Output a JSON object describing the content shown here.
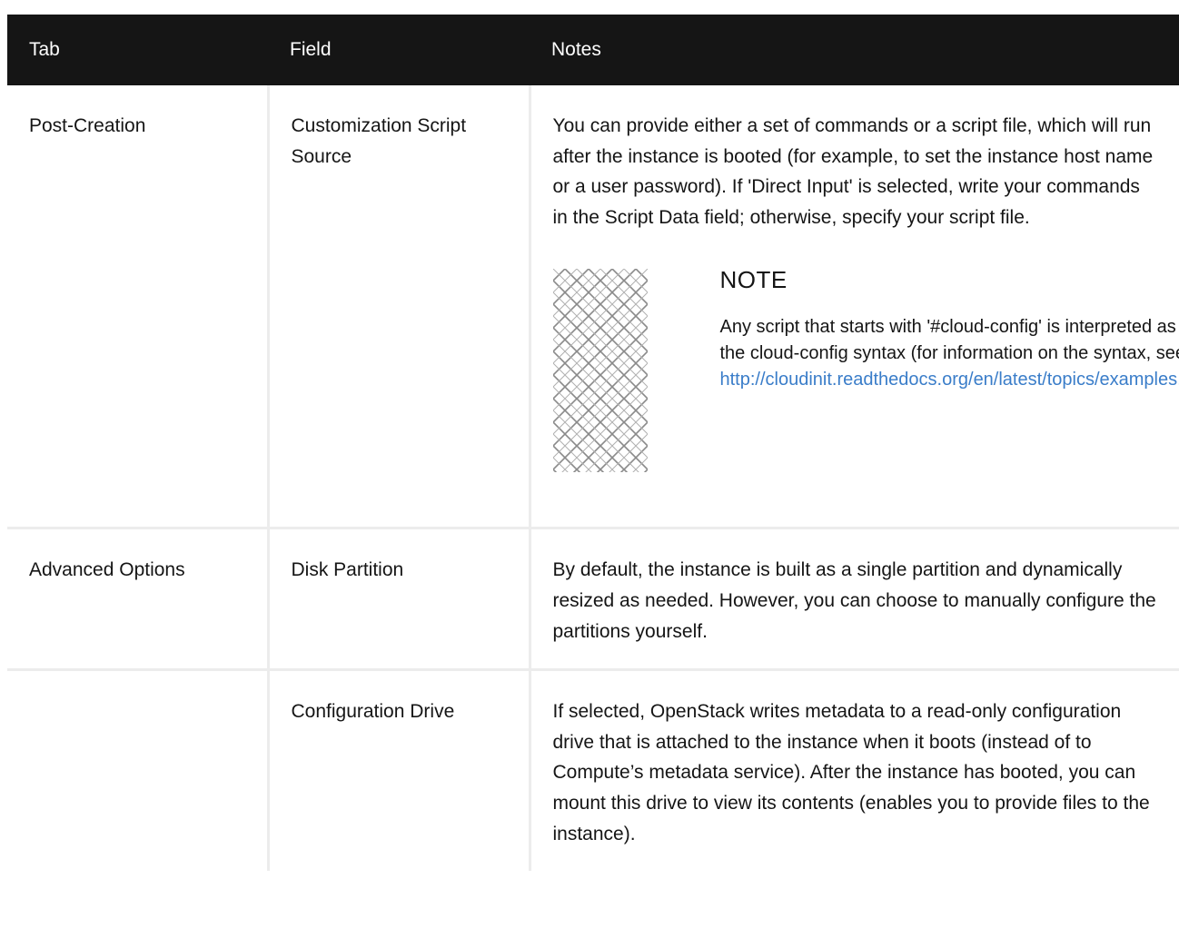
{
  "table": {
    "headers": {
      "tab": "Tab",
      "field": "Field",
      "notes": "Notes"
    },
    "rows": [
      {
        "tab": "Post-Creation",
        "field": "Customization Script Source",
        "notes": "You can provide either a set of commands or a script file, which will run after the instance is booted (for example, to set the instance host name or a user password). If 'Direct Input' is selected, write your commands in the Script Data field; otherwise, specify your script file.",
        "note": {
          "title": "NOTE",
          "text_before": "Any script that starts with '#cloud-config' is interpreted as using the cloud-config syntax (for information on the syntax, see ",
          "link": "http://cloudinit.readthedocs.org/en/latest/topics/examples.html",
          "text_after": ")."
        }
      },
      {
        "tab": "Advanced Options",
        "field": "Disk Partition",
        "notes": "By default, the instance is built as a single partition and dynamically resized as needed. However, you can choose to manually configure the partitions yourself."
      },
      {
        "tab": "",
        "field": "Configuration Drive",
        "notes": "If selected, OpenStack writes metadata to a read-only configuration drive that is attached to the instance when it boots (instead of to Compute’s metadata service). After the instance has booted, you can mount this drive to view its contents (enables you to provide files to the instance)."
      }
    ]
  },
  "icons": {
    "note_icon": "lattice-pattern-icon"
  },
  "colors": {
    "header_bg": "#151515",
    "header_text": "#ffffff",
    "border": "#ececec",
    "link": "#3a7dc9"
  }
}
